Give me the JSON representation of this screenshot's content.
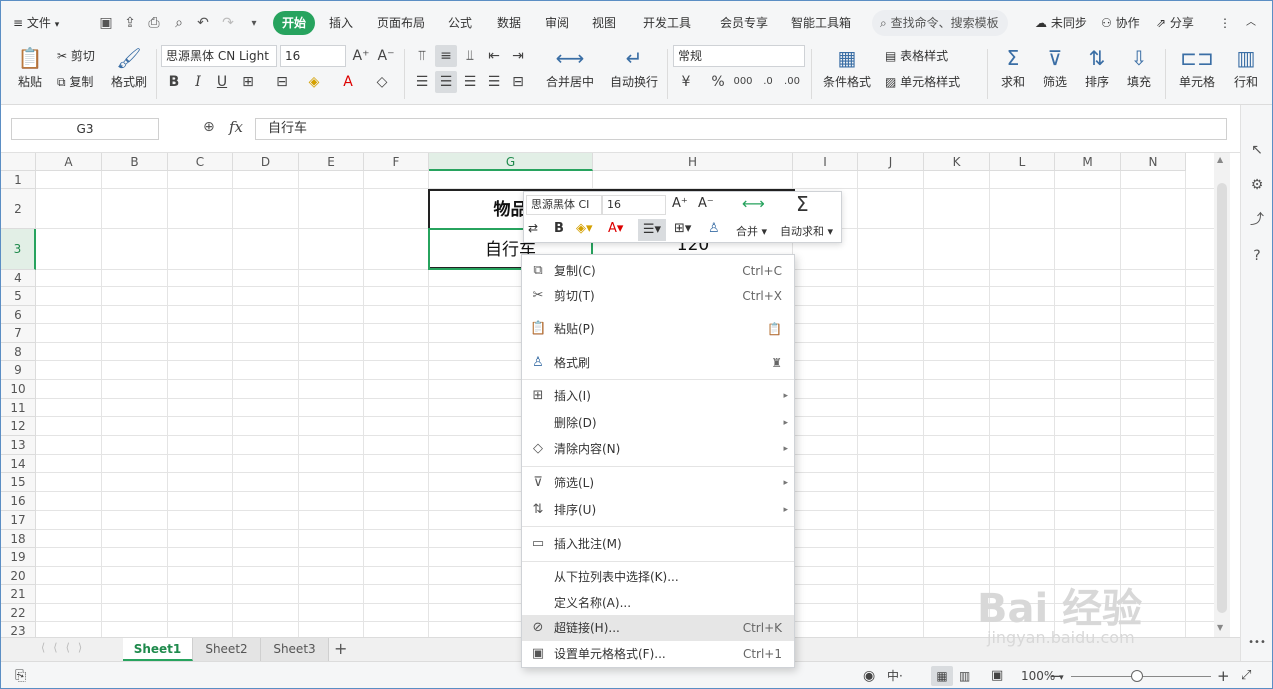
{
  "menu": {
    "file": "文件",
    "tabs": [
      "开始",
      "插入",
      "页面布局",
      "公式",
      "数据",
      "审阅",
      "视图",
      "开发工具",
      "会员专享",
      "智能工具箱"
    ],
    "active_tab": "开始",
    "search": "查找命令、搜索模板",
    "unsynced": "未同步",
    "collab": "协作",
    "share": "分享"
  },
  "ribbon": {
    "paste": "粘贴",
    "cut": "剪切",
    "copy": "复制",
    "format_painter": "格式刷",
    "font_name": "思源黑体 CN Light",
    "font_size": "16",
    "merge_center": "合并居中",
    "wrap_text": "自动换行",
    "number_format": "常规",
    "conditional_format": "条件格式",
    "table_style": "表格样式",
    "cell_style": "单元格样式",
    "sum": "求和",
    "filter": "筛选",
    "sort": "排序",
    "fill": "填充",
    "cell": "单元格",
    "row_col": "行和",
    "percent": "%",
    "thousands": "000"
  },
  "formula_bar": {
    "name_box": "G3",
    "fx": "fx",
    "value": "自行车"
  },
  "grid": {
    "columns": [
      "A",
      "B",
      "C",
      "D",
      "E",
      "F",
      "G",
      "H",
      "I",
      "J",
      "K",
      "L",
      "M",
      "N"
    ],
    "selected_column": "G",
    "rows": [
      "1",
      "2",
      "3",
      "4",
      "5",
      "6",
      "7",
      "8",
      "9",
      "10",
      "11",
      "12",
      "13",
      "14",
      "15",
      "16",
      "17",
      "18",
      "19",
      "20",
      "21",
      "22",
      "23"
    ],
    "selected_row": "3",
    "cells": {
      "g2": "物品",
      "g3": "自行车",
      "h3": "120"
    }
  },
  "mini_toolbar": {
    "font_name": "思源黑体 CI",
    "font_size": "16",
    "merge": "合并",
    "autosum": "自动求和"
  },
  "context_menu": [
    {
      "label": "复制(C)",
      "shortcut": "Ctrl+C",
      "icon": "copy-icon"
    },
    {
      "label": "剪切(T)",
      "shortcut": "Ctrl+X",
      "icon": "scissors-icon"
    },
    {
      "label": "粘贴(P)",
      "shortcut": "",
      "icon": "paste-icon"
    },
    {
      "label": "格式刷",
      "shortcut": "",
      "icon": "brush-icon"
    },
    {
      "label": "插入(I)",
      "shortcut": "",
      "icon": "insert-icon"
    },
    {
      "label": "删除(D)",
      "shortcut": "",
      "icon": ""
    },
    {
      "label": "清除内容(N)",
      "shortcut": "",
      "icon": "eraser-icon"
    },
    {
      "label": "筛选(L)",
      "shortcut": "",
      "icon": "filter-icon"
    },
    {
      "label": "排序(U)",
      "shortcut": "",
      "icon": "sort-icon"
    },
    {
      "label": "插入批注(M)",
      "shortcut": "",
      "icon": "comment-icon"
    },
    {
      "label": "从下拉列表中选择(K)...",
      "shortcut": "",
      "icon": ""
    },
    {
      "label": "定义名称(A)...",
      "shortcut": "",
      "icon": ""
    },
    {
      "label": "超链接(H)...",
      "shortcut": "Ctrl+K",
      "icon": "link-icon"
    },
    {
      "label": "设置单元格格式(F)...",
      "shortcut": "Ctrl+1",
      "icon": "format-cells-icon"
    }
  ],
  "sheets": [
    "Sheet1",
    "Sheet2",
    "Sheet3"
  ],
  "active_sheet": "Sheet1",
  "status": {
    "zoom": "100%"
  },
  "watermark": {
    "brand": "Bai 经验",
    "url": "jingyan.baidu.com"
  },
  "colors": {
    "accent": "#27a35e",
    "border": "#5b8ec4"
  }
}
